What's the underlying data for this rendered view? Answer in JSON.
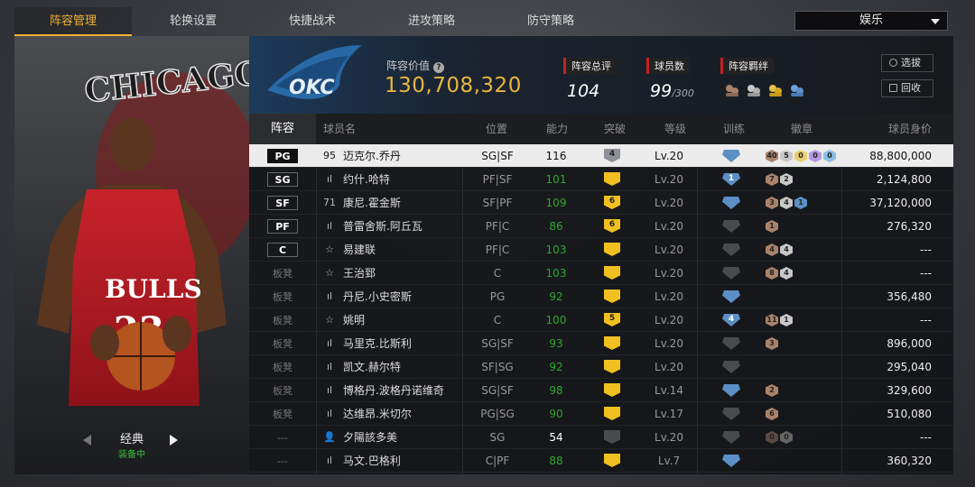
{
  "tabs": [
    {
      "label": "阵容管理",
      "active": true
    },
    {
      "label": "轮换设置",
      "active": false
    },
    {
      "label": "快捷战术",
      "active": false
    },
    {
      "label": "进攻策略",
      "active": false
    },
    {
      "label": "防守策略",
      "active": false
    }
  ],
  "mode_select": {
    "value": "娱乐"
  },
  "player_panel": {
    "jersey_text": "CHICAGO BULLS",
    "style_name": "经典",
    "style_status": "装备中"
  },
  "summary": {
    "team_logo_text": "OKC",
    "value_label": "阵容价值",
    "value": "130,708,320",
    "overall_label": "阵容总评",
    "overall": "104",
    "count_label": "球员数",
    "count": "99",
    "count_max": "/300",
    "chem_label": "阵容羁绊",
    "chem_icons": [
      "chem-bronze-icon",
      "chem-silver-icon",
      "chem-gold-icon",
      "chem-blue-icon"
    ],
    "btn_select": "选拔",
    "btn_recycle": "回收"
  },
  "columns": {
    "lineup": "阵容",
    "name": "球员名",
    "pos": "位置",
    "ovr": "能力",
    "breakthrough": "突破",
    "level": "等级",
    "training": "训练",
    "badges": "徽章",
    "price": "球员身价"
  },
  "colors": {
    "accent": "#f0b030",
    "green_ovr": "#2fa82f",
    "bronze": "#a9826a",
    "silver": "#c8c8c8",
    "gold": "#d8a920",
    "purple": "#b49ae0",
    "blue": "#5b8fc6"
  },
  "rows": [
    {
      "slot": "PG",
      "icon": "95",
      "name": "迈克尔.乔丹",
      "pos": "SG|SF",
      "ovr": "116",
      "ovr_color": "white",
      "brk": "4",
      "brk_color": "#8d9099",
      "lvl": "Lv.20",
      "train": "",
      "train_color": "#5b8fc6",
      "badges": [
        [
          "40",
          "#a9826a"
        ],
        [
          "5",
          "#c8c8c8"
        ],
        [
          "0",
          "#e8d070"
        ],
        [
          "0",
          "#b49ae0"
        ],
        [
          "0",
          "#8ac0e8"
        ]
      ],
      "price": "88,800,000",
      "selected": true
    },
    {
      "slot": "SG",
      "icon": "ıl",
      "name": "约什.哈特",
      "pos": "PF|SF",
      "ovr": "101",
      "ovr_color": "green",
      "brk": "",
      "brk_color": "#f0c020",
      "lvl": "Lv.20",
      "train": "1",
      "train_color": "#5b8fc6",
      "badges": [
        [
          "7",
          "#a9826a"
        ],
        [
          "2",
          "#c8c8c8"
        ]
      ],
      "price": "2,124,800"
    },
    {
      "slot": "SF",
      "icon": "71",
      "name": "康尼.霍金斯",
      "pos": "SF|PF",
      "ovr": "109",
      "ovr_color": "green",
      "brk": "6",
      "brk_color": "#f0c020",
      "lvl": "Lv.20",
      "train": "",
      "train_color": "#5b8fc6",
      "badges": [
        [
          "3",
          "#a9826a"
        ],
        [
          "4",
          "#c8c8c8"
        ],
        [
          "1",
          "#5b8fc6"
        ]
      ],
      "price": "37,120,000"
    },
    {
      "slot": "PF",
      "icon": "ıl",
      "name": "普雷舍斯.阿丘瓦",
      "pos": "PF|C",
      "ovr": "86",
      "ovr_color": "green",
      "brk": "6",
      "brk_color": "#f0c020",
      "lvl": "Lv.20",
      "train": "",
      "train_color": "#4a4b4f",
      "badges": [
        [
          "1",
          "#a9826a"
        ]
      ],
      "price": "276,320"
    },
    {
      "slot": "C",
      "icon": "☆",
      "name": "易建联",
      "pos": "PF|C",
      "ovr": "103",
      "ovr_color": "green",
      "brk": "",
      "brk_color": "#f0c020",
      "lvl": "Lv.20",
      "train": "",
      "train_color": "#4a4b4f",
      "badges": [
        [
          "4",
          "#a9826a"
        ],
        [
          "4",
          "#c8c8c8"
        ]
      ],
      "price": "---"
    },
    {
      "slot": "板凳",
      "icon": "☆",
      "name": "王治郅",
      "pos": "C",
      "ovr": "103",
      "ovr_color": "green",
      "brk": "",
      "brk_color": "#f0c020",
      "lvl": "Lv.20",
      "train": "",
      "train_color": "#4a4b4f",
      "badges": [
        [
          "8",
          "#a9826a"
        ],
        [
          "4",
          "#c8c8c8"
        ]
      ],
      "price": "---"
    },
    {
      "slot": "板凳",
      "icon": "ıl",
      "name": "丹尼.小史密斯",
      "pos": "PG",
      "ovr": "92",
      "ovr_color": "green",
      "brk": "",
      "brk_color": "#f0c020",
      "lvl": "Lv.20",
      "train": "",
      "train_color": "#5b8fc6",
      "badges": [],
      "price": "356,480"
    },
    {
      "slot": "板凳",
      "icon": "☆",
      "name": "姚明",
      "pos": "C",
      "ovr": "100",
      "ovr_color": "green",
      "brk": "5",
      "brk_color": "#f0c020",
      "lvl": "Lv.20",
      "train": "4",
      "train_color": "#5b8fc6",
      "badges": [
        [
          "11",
          "#a9826a"
        ],
        [
          "1",
          "#c8c8c8"
        ]
      ],
      "price": "---"
    },
    {
      "slot": "板凳",
      "icon": "ıl",
      "name": "马里克.比斯利",
      "pos": "SG|SF",
      "ovr": "93",
      "ovr_color": "green",
      "brk": "",
      "brk_color": "#f0c020",
      "lvl": "Lv.20",
      "train": "",
      "train_color": "#4a4b4f",
      "badges": [
        [
          "3",
          "#a9826a"
        ]
      ],
      "price": "896,000"
    },
    {
      "slot": "板凳",
      "icon": "ıl",
      "name": "凯文.赫尔特",
      "pos": "SF|SG",
      "ovr": "92",
      "ovr_color": "green",
      "brk": "",
      "brk_color": "#f0c020",
      "lvl": "Lv.20",
      "train": "",
      "train_color": "#4a4b4f",
      "badges": [],
      "price": "295,040"
    },
    {
      "slot": "板凳",
      "icon": "ıl",
      "name": "博格丹.波格丹诺维奇",
      "pos": "SG|SF",
      "ovr": "98",
      "ovr_color": "green",
      "brk": "",
      "brk_color": "#f0c020",
      "lvl": "Lv.14",
      "train": "",
      "train_color": "#5b8fc6",
      "badges": [
        [
          "2",
          "#a9826a"
        ]
      ],
      "price": "329,600"
    },
    {
      "slot": "板凳",
      "icon": "ıl",
      "name": "达维昂.米切尔",
      "pos": "PG|SG",
      "ovr": "90",
      "ovr_color": "green",
      "brk": "",
      "brk_color": "#f0c020",
      "lvl": "Lv.17",
      "train": "",
      "train_color": "#4a4b4f",
      "badges": [
        [
          "6",
          "#a9826a"
        ]
      ],
      "price": "510,080"
    },
    {
      "slot": "---",
      "icon": "👤",
      "name": "夕陽該多美",
      "pos": "SG",
      "ovr": "54",
      "ovr_color": "white",
      "brk": "",
      "brk_color": "#4a4b4f",
      "lvl": "Lv.20",
      "train": "",
      "train_color": "#4a4b4f",
      "badges": [
        [
          "0",
          "#5a4a44"
        ],
        [
          "0",
          "#666"
        ]
      ],
      "price": "---"
    },
    {
      "slot": "---",
      "icon": "ıl",
      "name": "马文.巴格利",
      "pos": "C|PF",
      "ovr": "88",
      "ovr_color": "green",
      "brk": "",
      "brk_color": "#f0c020",
      "lvl": "Lv.7",
      "train": "",
      "train_color": "#5b8fc6",
      "badges": [],
      "price": "360,320"
    }
  ]
}
